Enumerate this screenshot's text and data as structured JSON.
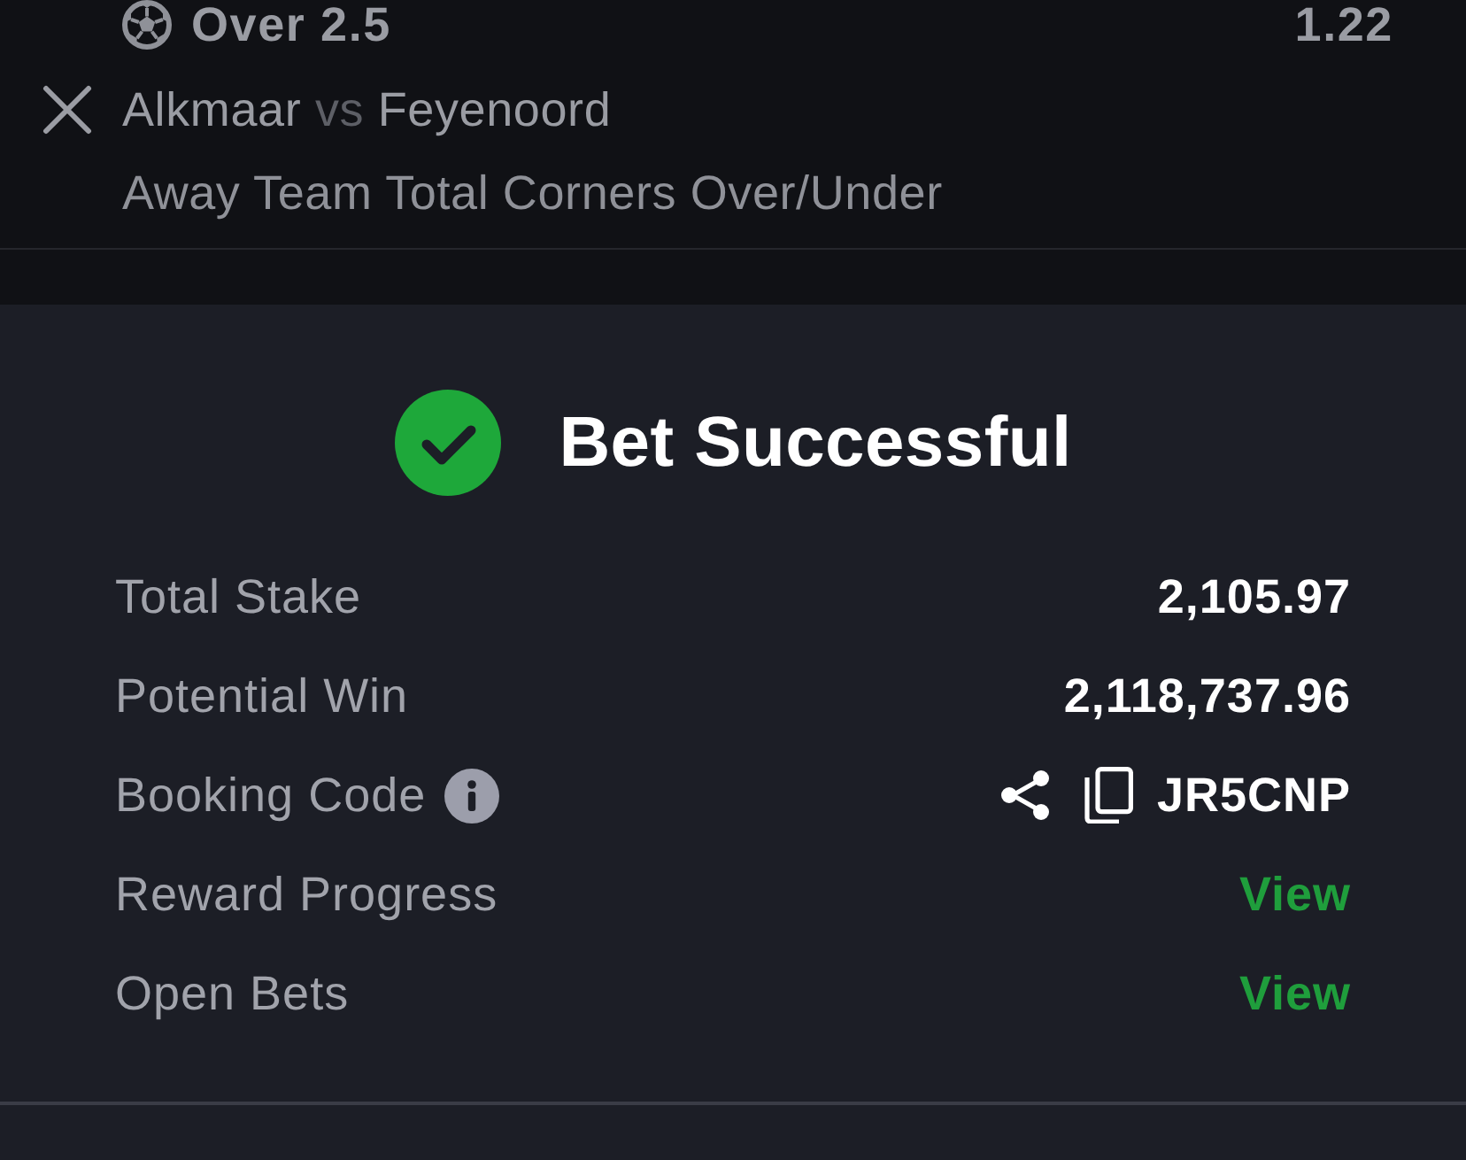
{
  "bets": [
    {
      "selection": "Over 2.5",
      "odds": "1.22",
      "match": {
        "home": "Alkmaar",
        "separator": "vs",
        "away": "Feyenoord"
      },
      "market": "Away Team Total Corners Over/Under"
    }
  ],
  "confirmation": {
    "title": "Bet Successful",
    "rows": [
      {
        "kind": "value",
        "label": "Total Stake",
        "value": "2,105.97"
      },
      {
        "kind": "value",
        "label": "Potential Win",
        "value": "2,118,737.96"
      },
      {
        "kind": "code",
        "label": "Booking Code",
        "value": "JR5CNP"
      },
      {
        "kind": "link",
        "label": "Reward Progress",
        "value": "View"
      },
      {
        "kind": "link",
        "label": "Open Bets",
        "value": "View"
      }
    ]
  }
}
